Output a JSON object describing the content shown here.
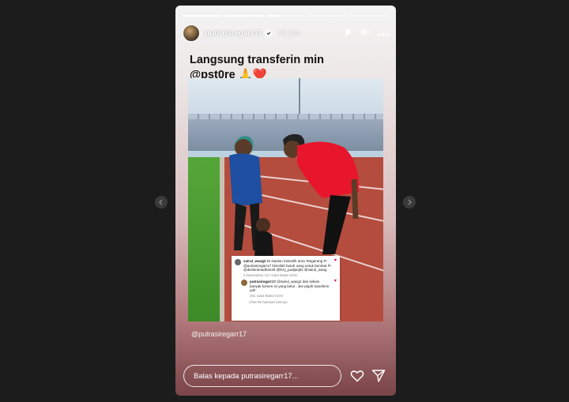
{
  "story": {
    "progress": [
      1,
      1,
      0.35,
      0,
      0
    ],
    "header": {
      "username": "putrasiregarr17",
      "time": "19 jam",
      "play_icon": "play-icon",
      "mute_icon": "muted-speaker-icon",
      "more_icon": "more-icon"
    },
    "caption_line1": "Langsung transferin min",
    "caption_line2": "@pst0re 🙏❤️",
    "photo": {
      "comments": [
        {
          "user": "sairul_wang2",
          "text": "Di stadion indomilk area Tangerang Pi @putrasiregarr17 bismilah butuh uang untuk berobat Pi @devkiramadhan28 @fery_pudjanj91 @sairul_wang",
          "meta": "2 Diamarken  117 suka  Balas  Kirim"
        },
        {
          "user": "putrasiregarr17",
          "text": "@sairul_wang2 dari sekian banyak komen ini yang betul , oke papih transferin yah",
          "meta": "281 suka  Balas  Kirim"
        }
      ],
      "view_replies": "Lihat 85 balasan lainnya"
    },
    "credit": "@putrasiregarr17",
    "reply_placeholder": "Balas kepada putrasiregarr17...",
    "colors": {
      "accent_heart": "#e0245e",
      "background": "#1c1c1c"
    }
  }
}
